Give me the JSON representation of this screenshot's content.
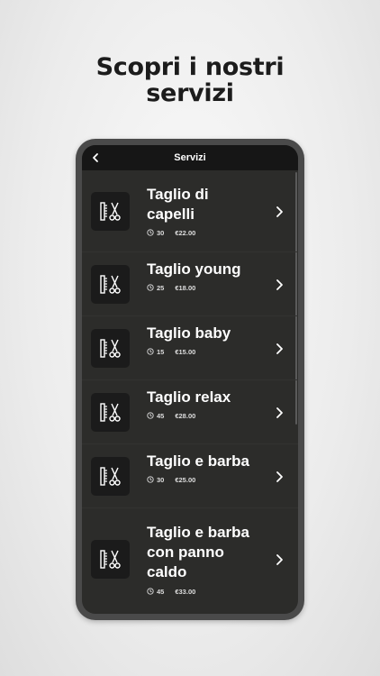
{
  "headline": {
    "line1": "Scopri i nostri",
    "line2": "servizi"
  },
  "navbar": {
    "title": "Servizi",
    "back_icon": "chevron-left-icon"
  },
  "services": [
    {
      "name_lines": [
        "Taglio di",
        "capelli"
      ],
      "duration": "30",
      "price": "€22.00"
    },
    {
      "name_lines": [
        "Taglio young"
      ],
      "duration": "25",
      "price": "€18.00"
    },
    {
      "name_lines": [
        "Taglio baby"
      ],
      "duration": "15",
      "price": "€15.00"
    },
    {
      "name_lines": [
        "Taglio relax"
      ],
      "duration": "45",
      "price": "€28.00"
    },
    {
      "name_lines": [
        "Taglio e barba"
      ],
      "duration": "30",
      "price": "€25.00"
    },
    {
      "name_lines": [
        "Taglio e barba",
        "con panno",
        "caldo"
      ],
      "duration": "45",
      "price": "€33.00"
    }
  ],
  "icons": {
    "service": "comb-scissors-icon",
    "duration": "clock-icon",
    "open": "chevron-right-icon"
  },
  "colors": {
    "screen_background": "#2c2c2a",
    "navbar_background": "#161616",
    "icon_tile": "#1b1b1b",
    "text": "#ffffff"
  }
}
